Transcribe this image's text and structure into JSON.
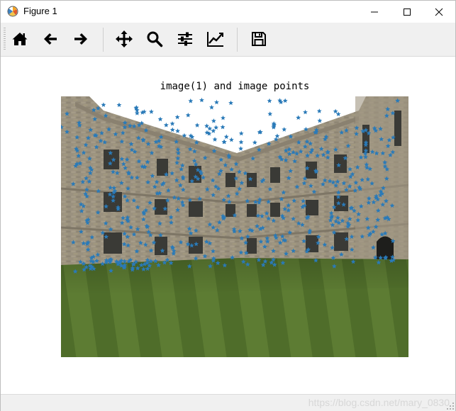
{
  "window": {
    "title": "Figure 1"
  },
  "toolbar": {
    "buttons": [
      {
        "name": "home",
        "icon": "home-icon"
      },
      {
        "name": "back",
        "icon": "arrow-left-icon"
      },
      {
        "name": "forward",
        "icon": "arrow-right-icon"
      },
      {
        "name": "pan",
        "icon": "move-icon"
      },
      {
        "name": "zoom",
        "icon": "zoom-icon"
      },
      {
        "name": "subplots",
        "icon": "sliders-icon"
      },
      {
        "name": "edit-axes",
        "icon": "line-chart-icon"
      },
      {
        "name": "save",
        "icon": "save-icon"
      }
    ]
  },
  "figure": {
    "title": "image(1) and image points",
    "marker_color": "#2a7ab8"
  },
  "status": {
    "watermark": "https://blog.csdn.net/mary_0830"
  }
}
